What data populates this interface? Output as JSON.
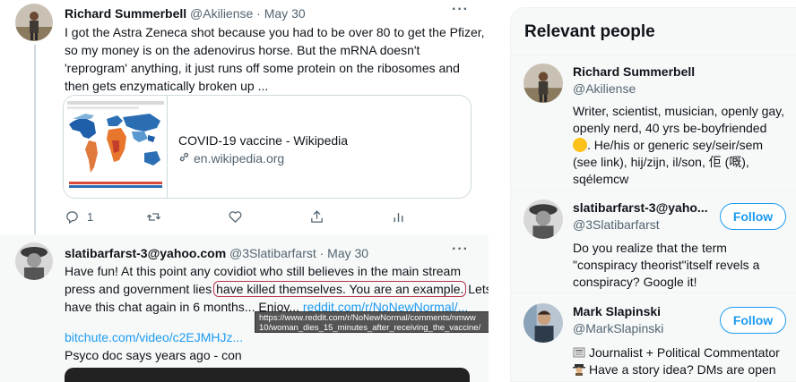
{
  "tweet1": {
    "author_name": "Richard Summerbell",
    "author_meta": "@Akiliense · May 30",
    "more": "···",
    "lines": [
      "I got the Astra Zeneca shot because you had to be over 80 to get the Pfizer,",
      "so my money is on the adenovirus horse.  But the mRNA doesn't",
      "'reprogram' anything, it just runs off some protein on the ribosomes and",
      "then gets enzymatically broken up ..."
    ],
    "card": {
      "title": "COVID-19 vaccine - Wikipedia",
      "domain": "en.wikipedia.org"
    },
    "actions": {
      "reply_count": "1"
    }
  },
  "tweet2": {
    "author_name": "slatibarfarst-3@yahoo.com",
    "author_meta": "@3Slatibarfarst · May 30",
    "more": "···",
    "line1": "Have fun!   At this point any covidiot who still believes in the main stream",
    "line2_before": "press and government lies ",
    "line2_circled": "have killed themselves.  You are an example.",
    "line2_after": " Lets",
    "line3_before": "have this chat again in 6 months...  Enjoy...  ",
    "line3_link": "reddit.com/r/NoNewNormal/...",
    "line4_link": "bitchute.com/video/c2EJMHJz...",
    "line5": "Psyco doc says years ago - con"
  },
  "tooltip": {
    "line1": "https://www.reddit.com/r/NoNewNormal/comments/nmww",
    "line2": "10/woman_dies_15_minutes_after_receiving_the_vaccine/"
  },
  "panel": {
    "title": "Relevant people",
    "people": [
      {
        "name": "Richard Summerbell",
        "handle": "@Akiliense",
        "bio_lines": [
          "Writer, scientist, musician, openly gay,",
          "openly nerd, 40 yrs be-boyfriended",
          ". He/his or generic sey/seir/sem",
          "(see link), hij/zijn, il/son, 佢 (嘅),",
          "sqélemcw"
        ]
      },
      {
        "name": "slatibarfarst-3@yaho...",
        "handle": "@3Slatibarfarst",
        "follow_label": "Follow",
        "bio_lines": [
          "Do you realize that the term",
          "\"conspiracy theorist\"itself revels a",
          "conspiracy? Google it!"
        ]
      },
      {
        "name": "Mark Slapinski",
        "handle": "@MarkSlapinski",
        "follow_label": "Follow",
        "bio_lines": [
          "Journalist + Political Commentator",
          "Have a story idea? DMs are open"
        ]
      }
    ]
  },
  "colors": {
    "accent": "#1d9bf0",
    "text": "#0f1419",
    "muted": "#536471",
    "circle": "#b8324b"
  }
}
